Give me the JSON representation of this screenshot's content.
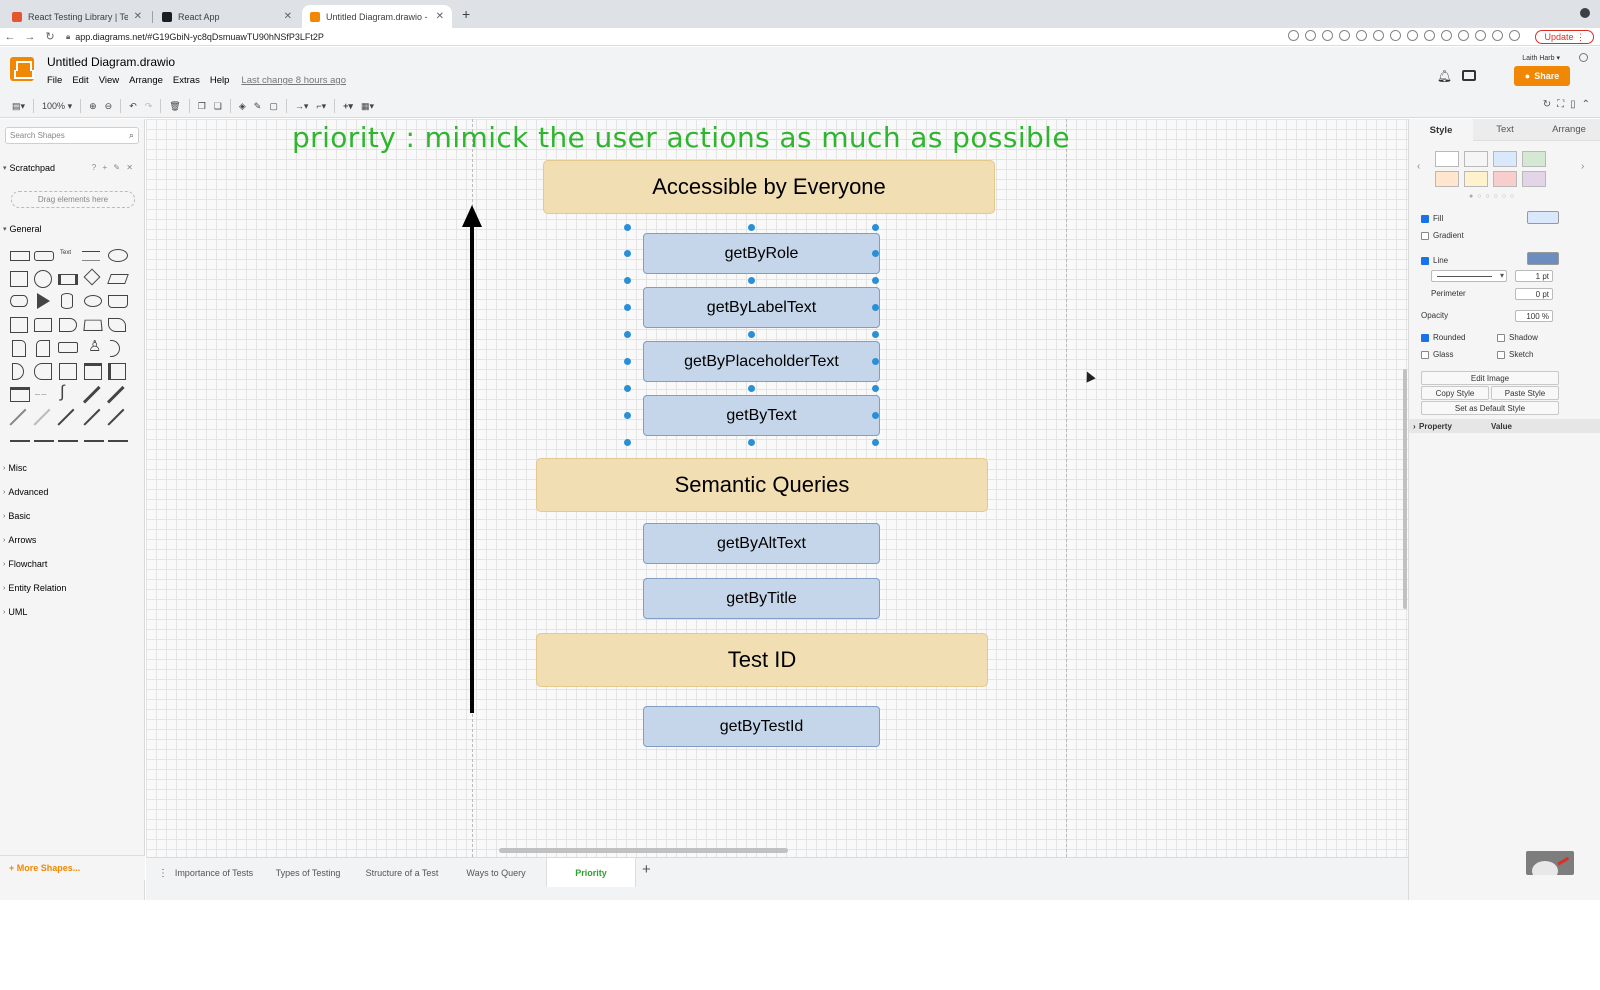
{
  "browser": {
    "tabs": [
      {
        "title": "React Testing Library | Testing",
        "active": false,
        "favicon_color": "#e4572e"
      },
      {
        "title": "React App",
        "active": false,
        "favicon_color": "#1b1f23"
      },
      {
        "title": "Untitled Diagram.drawio - diag",
        "active": true,
        "favicon_color": "#f08705"
      }
    ],
    "url": "app.diagrams.net/#G19GbiN-yc8qDsmuawTU90hNSfP3LFt2P",
    "update_label": "Update"
  },
  "app": {
    "title": "Untitled Diagram.drawio",
    "menu": [
      "File",
      "Edit",
      "View",
      "Arrange",
      "Extras",
      "Help"
    ],
    "last_change": "Last change 8 hours ago",
    "user": "Laith Harb",
    "share_label": "Share",
    "zoom": "100%",
    "brand_color": "#f08705"
  },
  "sidebar": {
    "search_placeholder": "Search Shapes",
    "scratchpad_label": "Scratchpad",
    "scratchpad_tools": "? + ✎ ✕",
    "drag_hint": "Drag elements here",
    "general_label": "General",
    "shape_label_text": "Text",
    "sections": [
      "Misc",
      "Advanced",
      "Basic",
      "Arrows",
      "Flowchart",
      "Entity Relation",
      "UML"
    ],
    "more_shapes": "+ More Shapes..."
  },
  "canvas": {
    "note": "priority : mimick the user actions as much as possible",
    "note_color": "#2fb52f",
    "groups": [
      {
        "title": "Accessible by Everyone",
        "queries": [
          "getByRole",
          "getByLabelText",
          "getByPlaceholderText",
          "getByText"
        ]
      },
      {
        "title": "Semantic Queries",
        "queries": [
          "getByAltText",
          "getByTitle"
        ]
      },
      {
        "title": "Test ID",
        "queries": [
          "getByTestId"
        ]
      }
    ],
    "header_fill": "#f2deb3",
    "query_fill": "#c6d6ea"
  },
  "pages": {
    "tabs": [
      "Importance of Tests",
      "Types of Testing",
      "Structure of a Test",
      "Ways to Query",
      "Priority"
    ],
    "active": "Priority",
    "active_color": "#2fa02f"
  },
  "format_panel": {
    "tabs": [
      "Style",
      "Text",
      "Arrange"
    ],
    "active_tab": "Style",
    "swatch_colors": [
      "#ffffff",
      "#f5f5f5",
      "#dae8fc",
      "#d5e8d4",
      "#ffe6cc",
      "#fff2cc",
      "#f8cecc",
      "#e1d5e7"
    ],
    "fill_label": "Fill",
    "fill_checked": true,
    "gradient_label": "Gradient",
    "gradient_checked": false,
    "line_label": "Line",
    "line_checked": true,
    "line_width": "1 pt",
    "perimeter_label": "Perimeter",
    "perimeter_value": "0 pt",
    "opacity_label": "Opacity",
    "opacity_value": "100 %",
    "rounded_label": "Rounded",
    "rounded_checked": true,
    "shadow_label": "Shadow",
    "shadow_checked": false,
    "glass_label": "Glass",
    "glass_checked": false,
    "sketch_label": "Sketch",
    "sketch_checked": false,
    "edit_image": "Edit Image",
    "copy_style": "Copy Style",
    "paste_style": "Paste Style",
    "set_default_style": "Set as Default Style",
    "property_header": "Property",
    "value_header": "Value",
    "fill_color": "#dae8fc",
    "line_color": "#6c8ebf"
  }
}
